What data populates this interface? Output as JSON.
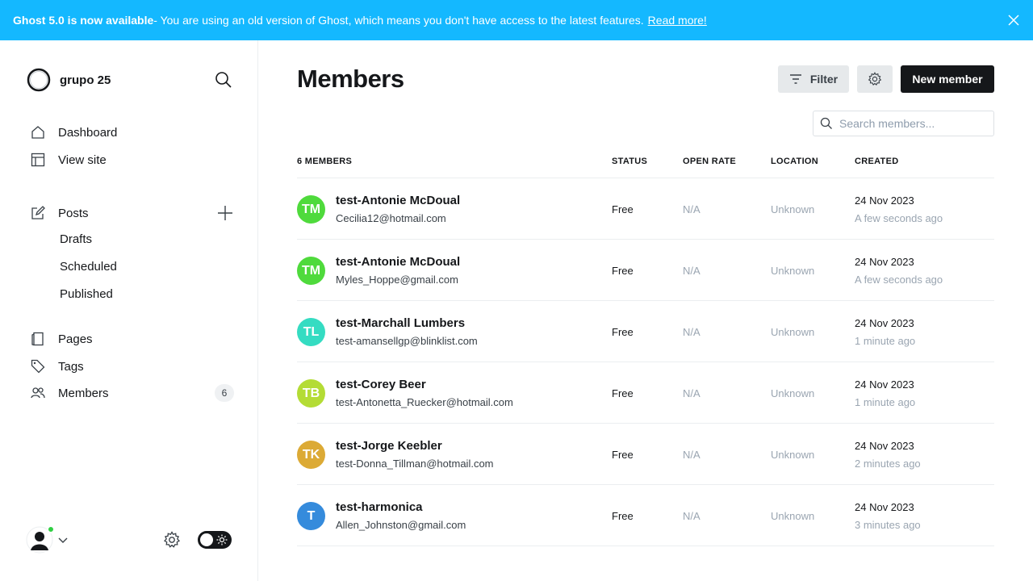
{
  "banner": {
    "headline": "Ghost 5.0 is now available",
    "message": " - You are using an old version of Ghost, which means you don't have access to the latest features.",
    "link": "Read more!",
    "bg_color": "#14b8ff"
  },
  "sidebar": {
    "site_name": "grupo 25",
    "nav": {
      "dashboard": "Dashboard",
      "view_site": "View site",
      "posts": "Posts",
      "drafts": "Drafts",
      "scheduled": "Scheduled",
      "published": "Published",
      "pages": "Pages",
      "tags": "Tags",
      "members": "Members",
      "members_count": "6"
    }
  },
  "main": {
    "title": "Members",
    "filter_label": "Filter",
    "new_member_label": "New member",
    "search_placeholder": "Search members...",
    "columns": {
      "members": "6 MEMBERS",
      "status": "STATUS",
      "open_rate": "OPEN RATE",
      "location": "LOCATION",
      "created": "CREATED"
    },
    "members": [
      {
        "initials": "TM",
        "color": "#4fda3c",
        "name": "test-Antonie McDoual",
        "email": "Cecilia12@hotmail.com",
        "status": "Free",
        "open_rate": "N/A",
        "location": "Unknown",
        "date": "24 Nov 2023",
        "ago": "A few seconds ago"
      },
      {
        "initials": "TM",
        "color": "#4fda3c",
        "name": "test-Antonie McDoual",
        "email": "Myles_Hoppe@gmail.com",
        "status": "Free",
        "open_rate": "N/A",
        "location": "Unknown",
        "date": "24 Nov 2023",
        "ago": "A few seconds ago"
      },
      {
        "initials": "TL",
        "color": "#35dcc2",
        "name": "test-Marchall Lumbers",
        "email": "test-amansellgp@blinklist.com",
        "status": "Free",
        "open_rate": "N/A",
        "location": "Unknown",
        "date": "24 Nov 2023",
        "ago": "1 minute ago"
      },
      {
        "initials": "TB",
        "color": "#b4dc35",
        "name": "test-Corey Beer",
        "email": "test-Antonetta_Ruecker@hotmail.com",
        "status": "Free",
        "open_rate": "N/A",
        "location": "Unknown",
        "date": "24 Nov 2023",
        "ago": "1 minute ago"
      },
      {
        "initials": "TK",
        "color": "#dcaa35",
        "name": "test-Jorge Keebler",
        "email": "test-Donna_Tillman@hotmail.com",
        "status": "Free",
        "open_rate": "N/A",
        "location": "Unknown",
        "date": "24 Nov 2023",
        "ago": "2 minutes ago"
      },
      {
        "initials": "T",
        "color": "#358bdc",
        "name": "test-harmonica",
        "email": "Allen_Johnston@gmail.com",
        "status": "Free",
        "open_rate": "N/A",
        "location": "Unknown",
        "date": "24 Nov 2023",
        "ago": "3 minutes ago"
      }
    ]
  }
}
